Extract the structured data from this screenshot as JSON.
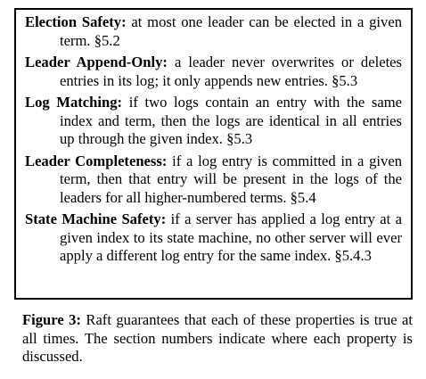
{
  "properties": [
    {
      "term": "Election Safety:",
      "text": "at most one leader can be elected in a given term. §5.2"
    },
    {
      "term": "Leader Append-Only:",
      "text": "a leader never overwrites or deletes entries in its log; it only appends new entries. §5.3"
    },
    {
      "term": "Log Matching:",
      "text": "if two logs contain an entry with the same index and term, then the logs are identical in all entries up through the given index. §5.3"
    },
    {
      "term": "Leader Completeness:",
      "text": "if a log entry is committed in a given term, then that entry will be present in the logs of the leaders for all higher-numbered terms. §5.4"
    },
    {
      "term": "State Machine Safety:",
      "text": "if a server has applied a log entry at a given index to its state machine, no other server will ever apply a different log entry for the same index. §5.4.3"
    }
  ],
  "caption": {
    "label": "Figure 3:",
    "text": "Raft guarantees that each of these properties is true at all times. The section numbers indicate where each property is discussed."
  }
}
